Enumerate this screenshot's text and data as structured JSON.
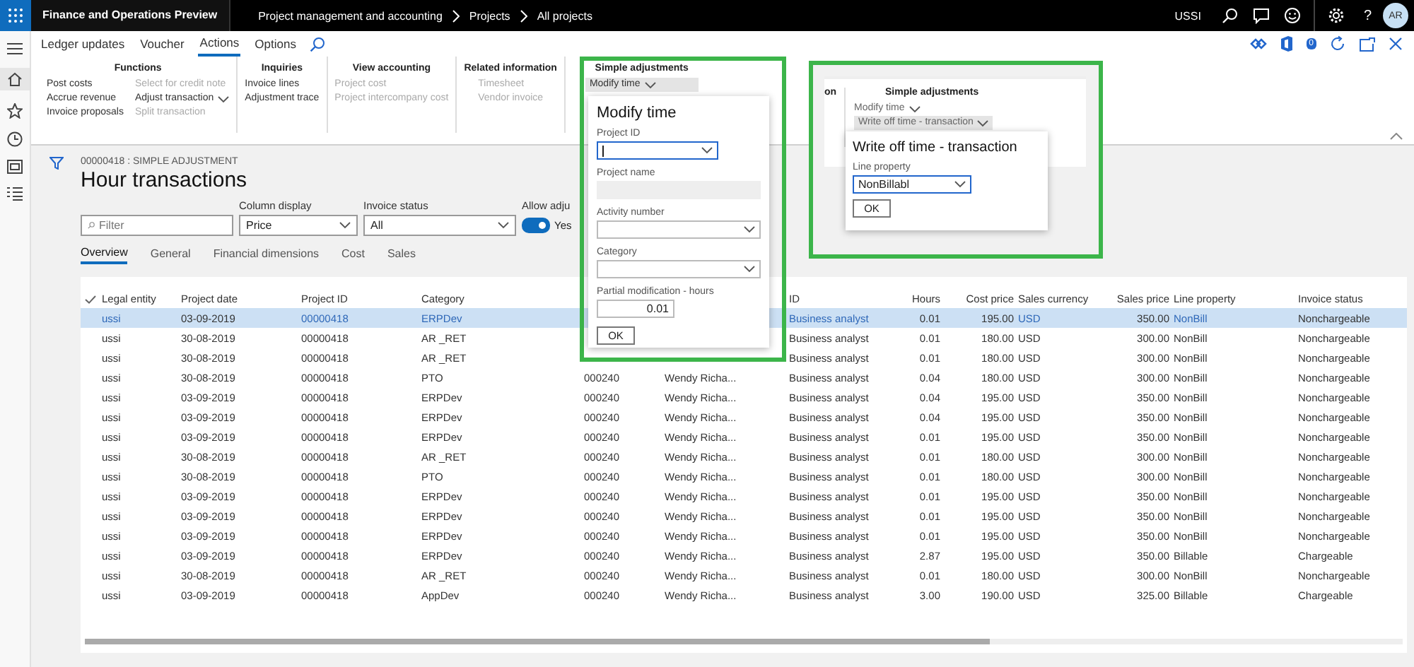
{
  "app": {
    "title": "Finance and Operations Preview",
    "breadcrumb": [
      "Project management and accounting",
      "Projects",
      "All projects"
    ],
    "company": "USSI",
    "help": "?",
    "avatar": "AR",
    "notification_count": "0"
  },
  "ribbon": {
    "tabs": [
      {
        "label": "Ledger updates",
        "selected": false
      },
      {
        "label": "Voucher",
        "selected": false
      },
      {
        "label": "Actions",
        "selected": true
      },
      {
        "label": "Options",
        "selected": false
      }
    ],
    "groups": [
      {
        "title": "Functions",
        "columns": [
          [
            {
              "label": "Post costs",
              "kind": "command",
              "disabled": false
            },
            {
              "label": "Accrue revenue",
              "kind": "command",
              "disabled": false
            },
            {
              "label": "Invoice proposals",
              "kind": "command",
              "disabled": false
            }
          ],
          [
            {
              "label": "Select for credit note",
              "kind": "command",
              "disabled": true
            },
            {
              "label": "Adjust transaction",
              "kind": "menu",
              "disabled": false,
              "expanded": false
            },
            {
              "label": "Split transaction",
              "kind": "command",
              "disabled": true
            }
          ]
        ]
      },
      {
        "title": "Inquiries",
        "columns": [
          [
            {
              "label": "Invoice lines",
              "kind": "command",
              "disabled": false
            },
            {
              "label": "Adjustment trace",
              "kind": "command",
              "disabled": false
            }
          ]
        ]
      },
      {
        "title": "View accounting",
        "columns": [
          [
            {
              "label": "Project cost",
              "kind": "command",
              "disabled": true
            },
            {
              "label": "Project intercompany cost",
              "kind": "command",
              "disabled": true
            }
          ]
        ]
      },
      {
        "title": "Related information",
        "columns": [
          [
            {
              "label": "Timesheet",
              "kind": "command",
              "disabled": true
            },
            {
              "label": "Vendor invoice",
              "kind": "command",
              "disabled": true
            }
          ]
        ]
      },
      {
        "title": "Simple adjustments",
        "columns": [
          [
            {
              "label": "Modify time",
              "kind": "menu",
              "disabled": false,
              "expanded": true
            }
          ]
        ]
      }
    ]
  },
  "page": {
    "caption": "00000418 : SIMPLE ADJUSTMENT",
    "title": "Hour transactions",
    "filter": {
      "placeholder": "Filter"
    },
    "column_display": {
      "label": "Column display",
      "value": "Price"
    },
    "invoice_status": {
      "label": "Invoice status",
      "value": "All"
    },
    "allow_adjust": {
      "label": "Allow adju",
      "on": true,
      "value": "Yes"
    },
    "tabs": [
      {
        "label": "Overview",
        "selected": true
      },
      {
        "label": "General",
        "selected": false
      },
      {
        "label": "Financial dimensions",
        "selected": false
      },
      {
        "label": "Cost",
        "selected": false
      },
      {
        "label": "Sales",
        "selected": false
      }
    ]
  },
  "grid": {
    "columns": [
      {
        "label": "Legal entity",
        "kind": "link"
      },
      {
        "label": "Project date",
        "kind": "text"
      },
      {
        "label": "Project ID",
        "kind": "link"
      },
      {
        "label": "Category",
        "kind": "link"
      },
      {
        "kind": "text"
      },
      {
        "kind": "text"
      },
      {
        "label": "ID",
        "kind": "link"
      },
      {
        "label": "Hours",
        "kind": "number"
      },
      {
        "label": "Cost price",
        "kind": "number"
      },
      {
        "label": "Sales currency",
        "kind": "link"
      },
      {
        "label": "Sales price",
        "kind": "number"
      },
      {
        "label": "Line property",
        "kind": "link"
      },
      {
        "label": "Invoice status",
        "kind": "text"
      }
    ],
    "rows": [
      {
        "selected": true,
        "cells": [
          "ussi",
          "03-09-2019",
          "00000418",
          "ERPDev",
          null,
          null,
          "Business analyst",
          "0.01",
          "195.00",
          "USD",
          "350.00",
          "NonBill",
          "Nonchargeable"
        ]
      },
      {
        "selected": false,
        "cells": [
          "ussi",
          "30-08-2019",
          "00000418",
          "AR _RET",
          null,
          null,
          "Business analyst",
          "0.01",
          "180.00",
          "USD",
          "300.00",
          "NonBill",
          "Nonchargeable"
        ]
      },
      {
        "selected": false,
        "cells": [
          "ussi",
          "30-08-2019",
          "00000418",
          "AR _RET",
          null,
          null,
          "Business analyst",
          "0.01",
          "180.00",
          "USD",
          "300.00",
          "NonBill",
          "Nonchargeable"
        ]
      },
      {
        "selected": false,
        "cells": [
          "ussi",
          "30-08-2019",
          "00000418",
          "PTO",
          "000240",
          "Wendy Richa...",
          "Business analyst",
          "0.04",
          "180.00",
          "USD",
          "300.00",
          "NonBill",
          "Nonchargeable"
        ]
      },
      {
        "selected": false,
        "cells": [
          "ussi",
          "03-09-2019",
          "00000418",
          "ERPDev",
          "000240",
          "Wendy Richa...",
          "Business analyst",
          "0.04",
          "195.00",
          "USD",
          "350.00",
          "NonBill",
          "Nonchargeable"
        ]
      },
      {
        "selected": false,
        "cells": [
          "ussi",
          "03-09-2019",
          "00000418",
          "ERPDev",
          "000240",
          "Wendy Richa...",
          "Business analyst",
          "0.04",
          "195.00",
          "USD",
          "350.00",
          "NonBill",
          "Nonchargeable"
        ]
      },
      {
        "selected": false,
        "cells": [
          "ussi",
          "03-09-2019",
          "00000418",
          "ERPDev",
          "000240",
          "Wendy Richa...",
          "Business analyst",
          "0.01",
          "195.00",
          "USD",
          "350.00",
          "NonBill",
          "Nonchargeable"
        ]
      },
      {
        "selected": false,
        "cells": [
          "ussi",
          "30-08-2019",
          "00000418",
          "AR _RET",
          "000240",
          "Wendy Richa...",
          "Business analyst",
          "0.01",
          "180.00",
          "USD",
          "300.00",
          "NonBill",
          "Nonchargeable"
        ]
      },
      {
        "selected": false,
        "cells": [
          "ussi",
          "30-08-2019",
          "00000418",
          "PTO",
          "000240",
          "Wendy Richa...",
          "Business analyst",
          "0.01",
          "180.00",
          "USD",
          "300.00",
          "NonBill",
          "Nonchargeable"
        ]
      },
      {
        "selected": false,
        "cells": [
          "ussi",
          "03-09-2019",
          "00000418",
          "ERPDev",
          "000240",
          "Wendy Richa...",
          "Business analyst",
          "0.01",
          "195.00",
          "USD",
          "350.00",
          "NonBill",
          "Nonchargeable"
        ]
      },
      {
        "selected": false,
        "cells": [
          "ussi",
          "03-09-2019",
          "00000418",
          "ERPDev",
          "000240",
          "Wendy Richa...",
          "Business analyst",
          "0.01",
          "195.00",
          "USD",
          "350.00",
          "NonBill",
          "Nonchargeable"
        ]
      },
      {
        "selected": false,
        "cells": [
          "ussi",
          "03-09-2019",
          "00000418",
          "ERPDev",
          "000240",
          "Wendy Richa...",
          "Business analyst",
          "0.01",
          "195.00",
          "USD",
          "350.00",
          "NonBill",
          "Nonchargeable"
        ]
      },
      {
        "selected": false,
        "cells": [
          "ussi",
          "03-09-2019",
          "00000418",
          "ERPDev",
          "000240",
          "Wendy Richa...",
          "Business analyst",
          "2.87",
          "195.00",
          "USD",
          "350.00",
          "Billable",
          "Chargeable"
        ]
      },
      {
        "selected": false,
        "cells": [
          "ussi",
          "30-08-2019",
          "00000418",
          "AR _RET",
          "000240",
          "Wendy Richa...",
          "Business analyst",
          "0.01",
          "180.00",
          "USD",
          "300.00",
          "NonBill",
          "Nonchargeable"
        ]
      },
      {
        "selected": false,
        "cells": [
          "ussi",
          "03-09-2019",
          "00000418",
          "AppDev",
          "000240",
          "Wendy Richa...",
          "Business analyst",
          "3.00",
          "190.00",
          "USD",
          "325.00",
          "Billable",
          "Chargeable"
        ]
      }
    ]
  },
  "modify_time_panel": {
    "title": "Modify time",
    "fields": [
      {
        "label": "Project ID",
        "kind": "dropdown",
        "focused": true
      },
      {
        "label": "Project name",
        "kind": "readonly"
      },
      {
        "label": "Activity number",
        "kind": "dropdown",
        "focused": false
      },
      {
        "label": "Category",
        "kind": "dropdown",
        "focused": false
      },
      {
        "label": "Partial modification - hours",
        "kind": "number",
        "value": "0.01",
        "focused": false
      }
    ],
    "ok": "OK"
  },
  "callout": {
    "cut_label": "on",
    "group_title": "Simple adjustments",
    "menus": [
      {
        "label": "Modify time",
        "expanded": false
      },
      {
        "label": "Write off time - transaction",
        "expanded": true
      }
    ],
    "panel": {
      "title": "Write off time - transaction",
      "field": {
        "label": "Line property",
        "value": "NonBillabl",
        "focused": true
      },
      "ok": "OK"
    }
  }
}
